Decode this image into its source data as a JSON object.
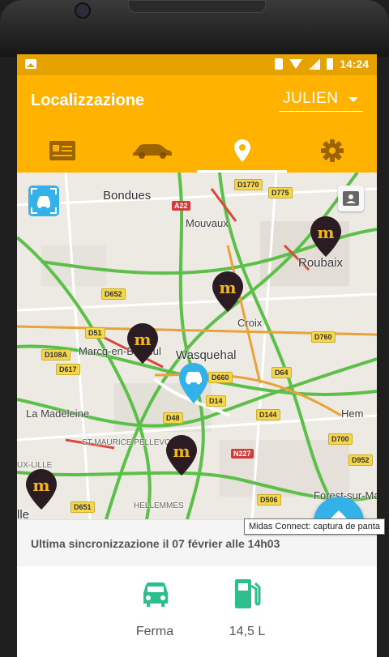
{
  "status_bar": {
    "time": "14:24"
  },
  "app_bar": {
    "title": "Localizzazione",
    "user": "JULIEN",
    "tabs": [
      {
        "name": "documents",
        "icon": "id-card-icon"
      },
      {
        "name": "vehicle",
        "icon": "car-icon"
      },
      {
        "name": "location",
        "icon": "location-pin-icon",
        "active": true
      },
      {
        "name": "settings",
        "icon": "gear-icon"
      }
    ]
  },
  "map": {
    "places": [
      "Bondues",
      "Mouvaux",
      "Roubaix",
      "Croix",
      "Marcq-en-Barœul",
      "Wasquehal",
      "La Madeleine",
      "ST MAURICE PELLEVOISIN",
      "HELLEMMES",
      "Hem",
      "Forest-sur-Ma",
      "UX-LILLE",
      "lle"
    ],
    "roads": [
      "D1770",
      "D775",
      "A22",
      "D652",
      "D51",
      "D108A",
      "D617",
      "D760",
      "D64",
      "D660",
      "D14",
      "D48",
      "D144",
      "D700",
      "D952",
      "N227",
      "D506",
      "D651"
    ],
    "markers": [
      "midas-marker",
      "midas-marker",
      "midas-marker",
      "midas-marker",
      "midas-marker",
      "car-marker"
    ]
  },
  "sync": {
    "text": "Ultima sincronizzazione il 07 février alle 14h03"
  },
  "info": {
    "status_label": "Ferma",
    "fuel_label": "14,5 L"
  },
  "tooltip": "Midas Connect: captura de panta",
  "colors": {
    "primary": "#FFB300",
    "status_bar": "#E6A200",
    "accent_blue": "#33B1E8",
    "green": "#2DBE8C"
  }
}
